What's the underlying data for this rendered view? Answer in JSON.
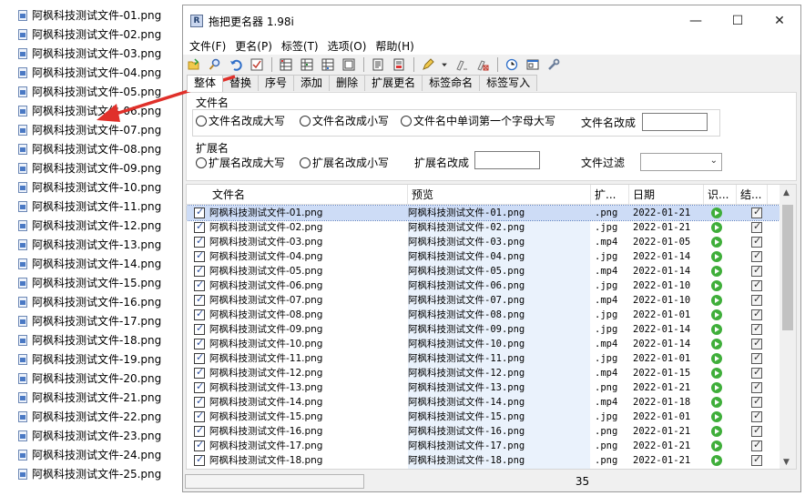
{
  "desktop_files": [
    "阿枫科技测试文件-01.png",
    "阿枫科技测试文件-02.png",
    "阿枫科技测试文件-03.png",
    "阿枫科技测试文件-04.png",
    "阿枫科技测试文件-05.png",
    "阿枫科技测试文件-06.png",
    "阿枫科技测试文件-07.png",
    "阿枫科技测试文件-08.png",
    "阿枫科技测试文件-09.png",
    "阿枫科技测试文件-10.png",
    "阿枫科技测试文件-11.png",
    "阿枫科技测试文件-12.png",
    "阿枫科技测试文件-13.png",
    "阿枫科技测试文件-14.png",
    "阿枫科技测试文件-15.png",
    "阿枫科技测试文件-16.png",
    "阿枫科技测试文件-17.png",
    "阿枫科技测试文件-18.png",
    "阿枫科技测试文件-19.png",
    "阿枫科技测试文件-20.png",
    "阿枫科技测试文件-21.png",
    "阿枫科技测试文件-22.png",
    "阿枫科技测试文件-23.png",
    "阿枫科技测试文件-24.png",
    "阿枫科技测试文件-25.png"
  ],
  "window": {
    "title": "拖把更名器 1.98i",
    "minimize": "—",
    "maximize": "☐",
    "close": "✕"
  },
  "menu": [
    "文件(F)",
    "更名(P)",
    "标签(T)",
    "选项(O)",
    "帮助(H)"
  ],
  "toolbar_icons": [
    "open-folder-icon",
    "search-icon",
    "undo-icon",
    "check-icon",
    "grid-icon-1",
    "grid-icon-2",
    "grid-icon-3",
    "grid-icon-4",
    "document-icon",
    "report-icon",
    "pen-icon",
    "dropdown-arrow-icon",
    "eraser-icon",
    "clear-icon",
    "clock-icon",
    "window-icon",
    "wrench-icon"
  ],
  "tabs": [
    "整体",
    "替换",
    "序号",
    "添加",
    "删除",
    "扩展更名",
    "标签命名",
    "标签写入"
  ],
  "filename_group": {
    "label": "文件名",
    "options": [
      "文件名改成大写",
      "文件名改成小写",
      "文件名中单词第一个字母大写"
    ],
    "change_label": "文件名改成",
    "change_value": ""
  },
  "ext_group": {
    "label": "扩展名",
    "options": [
      "扩展名改成大写",
      "扩展名改成小写"
    ],
    "change_label": "扩展名改成",
    "change_value": "",
    "filter_label": "文件过滤",
    "filter_value": ""
  },
  "columns": [
    "文件名",
    "预览",
    "扩...",
    "日期",
    "识...",
    "结..."
  ],
  "rows": [
    {
      "name": "阿枫科技测试文件-01.png",
      "preview": "阿枫科技测试文件-01.png",
      "ext": ".png",
      "date": "2022-01-21"
    },
    {
      "name": "阿枫科技测试文件-02.png",
      "preview": "阿枫科技测试文件-02.png",
      "ext": ".jpg",
      "date": "2022-01-21"
    },
    {
      "name": "阿枫科技测试文件-03.png",
      "preview": "阿枫科技测试文件-03.png",
      "ext": ".mp4",
      "date": "2022-01-05"
    },
    {
      "name": "阿枫科技测试文件-04.png",
      "preview": "阿枫科技测试文件-04.png",
      "ext": ".jpg",
      "date": "2022-01-14"
    },
    {
      "name": "阿枫科技测试文件-05.png",
      "preview": "阿枫科技测试文件-05.png",
      "ext": ".mp4",
      "date": "2022-01-14"
    },
    {
      "name": "阿枫科技测试文件-06.png",
      "preview": "阿枫科技测试文件-06.png",
      "ext": ".jpg",
      "date": "2022-01-10"
    },
    {
      "name": "阿枫科技测试文件-07.png",
      "preview": "阿枫科技测试文件-07.png",
      "ext": ".mp4",
      "date": "2022-01-10"
    },
    {
      "name": "阿枫科技测试文件-08.png",
      "preview": "阿枫科技测试文件-08.png",
      "ext": ".jpg",
      "date": "2022-01-01"
    },
    {
      "name": "阿枫科技测试文件-09.png",
      "preview": "阿枫科技测试文件-09.png",
      "ext": ".jpg",
      "date": "2022-01-14"
    },
    {
      "name": "阿枫科技测试文件-10.png",
      "preview": "阿枫科技测试文件-10.png",
      "ext": ".mp4",
      "date": "2022-01-14"
    },
    {
      "name": "阿枫科技测试文件-11.png",
      "preview": "阿枫科技测试文件-11.png",
      "ext": ".jpg",
      "date": "2022-01-01"
    },
    {
      "name": "阿枫科技测试文件-12.png",
      "preview": "阿枫科技测试文件-12.png",
      "ext": ".mp4",
      "date": "2022-01-15"
    },
    {
      "name": "阿枫科技测试文件-13.png",
      "preview": "阿枫科技测试文件-13.png",
      "ext": ".png",
      "date": "2022-01-21"
    },
    {
      "name": "阿枫科技测试文件-14.png",
      "preview": "阿枫科技测试文件-14.png",
      "ext": ".mp4",
      "date": "2022-01-18"
    },
    {
      "name": "阿枫科技测试文件-15.png",
      "preview": "阿枫科技测试文件-15.png",
      "ext": ".jpg",
      "date": "2022-01-01"
    },
    {
      "name": "阿枫科技测试文件-16.png",
      "preview": "阿枫科技测试文件-16.png",
      "ext": ".png",
      "date": "2022-01-21"
    },
    {
      "name": "阿枫科技测试文件-17.png",
      "preview": "阿枫科技测试文件-17.png",
      "ext": ".png",
      "date": "2022-01-21"
    },
    {
      "name": "阿枫科技测试文件-18.png",
      "preview": "阿枫科技测试文件-18.png",
      "ext": ".png",
      "date": "2022-01-21"
    }
  ],
  "status": {
    "count": "35"
  },
  "colors": {
    "selection": "#cddcf6",
    "preview_bg": "#eaf2fc",
    "go_green": "#3fae3a",
    "arrow_red": "#e0302a"
  }
}
